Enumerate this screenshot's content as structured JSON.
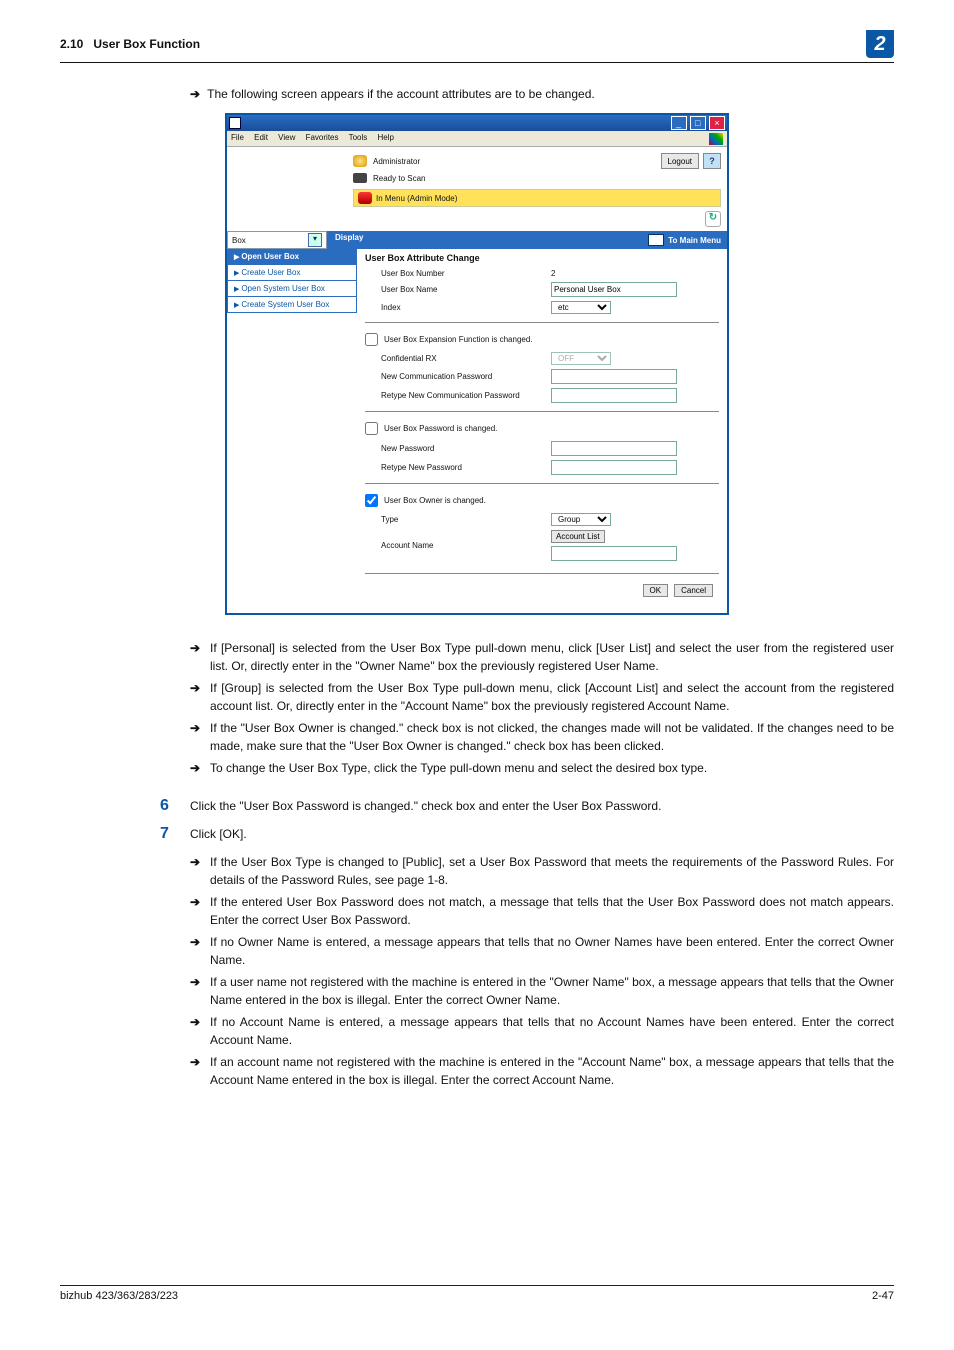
{
  "header": {
    "section_num": "2.10",
    "section_title": "User Box Function",
    "chapter_badge": "2"
  },
  "intro_bullet": "The following screen appears if the account attributes are to be changed.",
  "window": {
    "menus": [
      "File",
      "Edit",
      "View",
      "Favorites",
      "Tools",
      "Help"
    ],
    "admin_label": "Administrator",
    "logout": "Logout",
    "help": "?",
    "status": "Ready to Scan",
    "mode": "In Menu (Admin Mode)",
    "refresh": "↻",
    "tab_left": "Box",
    "tab_display": "Display",
    "to_main": "To Main Menu",
    "nav": [
      "Open User Box",
      "Create User Box",
      "Open System User Box",
      "Create System User Box"
    ],
    "panel_title": "User Box Attribute Change",
    "rows": {
      "ubn_label": "User Box Number",
      "ubn_val": "2",
      "ubname_label": "User Box Name",
      "ubname_val": "Personal User Box",
      "idx_label": "Index",
      "idx_val": "etc"
    },
    "sec1_chk": "User Box Expansion Function is changed.",
    "sec1_r1": "Confidential RX",
    "sec1_r1_val": "OFF",
    "sec1_r2": "New Communication Password",
    "sec1_r3": "Retype New Communication Password",
    "sec2_chk": "User Box Password is changed.",
    "sec2_r1": "New Password",
    "sec2_r2": "Retype New Password",
    "sec3_chk": "User Box Owner is changed.",
    "sec3_r1": "Type",
    "sec3_r1_val": "Group",
    "sec3_r2": "Account Name",
    "acct_btn": "Account List",
    "ok": "OK",
    "cancel": "Cancel"
  },
  "bullets_mid": [
    "If [Personal] is selected from the User Box Type pull-down menu, click [User List] and select the user from the registered user list. Or, directly enter in the \"Owner Name\" box the previously registered User Name.",
    "If [Group] is selected from the User Box Type pull-down menu, click [Account List] and select the account from the registered account list. Or, directly enter in the \"Account Name\" box the previously registered Account Name.",
    "If the \"User Box Owner is changed.\" check box is not clicked, the changes made will not be validated. If the changes need to be made, make sure that the \"User Box Owner is changed.\" check box has been clicked.",
    "To change the User Box Type, click the Type pull-down menu and select the desired box type."
  ],
  "step6": {
    "num": "6",
    "text": "Click the \"User Box Password is changed.\" check box and enter the User Box Password."
  },
  "step7": {
    "num": "7",
    "text": "Click [OK]."
  },
  "bullets7": [
    "If the User Box Type is changed to [Public], set a User Box Password that meets the requirements of the Password Rules. For details of the Password Rules, see page 1-8.",
    "If the entered User Box Password does not match, a message that tells that the User Box Password does not match appears. Enter the correct User Box Password.",
    "If no Owner Name is entered, a message appears that tells that no Owner Names have been entered. Enter the correct Owner Name.",
    "If a user name not registered with the machine is entered in the \"Owner Name\" box, a message appears that tells that the Owner Name entered in the box is illegal. Enter the correct Owner Name.",
    "If no Account Name is entered, a message appears that tells that no Account Names have been entered. Enter the correct Account Name.",
    "If an account name not registered with the machine is entered in the \"Account Name\" box, a message appears that tells that the Account Name entered in the box is illegal. Enter the correct Account Name."
  ],
  "footer": {
    "left": "bizhub 423/363/283/223",
    "right": "2-47"
  }
}
